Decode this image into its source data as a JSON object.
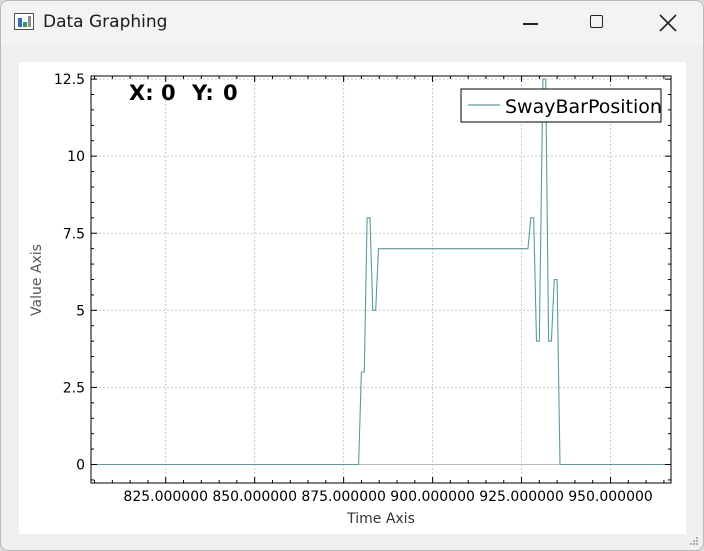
{
  "window": {
    "title": "Data Graphing",
    "icon": "chart-app-icon"
  },
  "titlebar_buttons": [
    "minimize-icon",
    "maximize-icon",
    "close-icon"
  ],
  "readout": {
    "x_label": "X:",
    "x_value": "0",
    "y_label": "Y:",
    "y_value": "0"
  },
  "chart_data": {
    "type": "line",
    "xlabel": "Time Axis",
    "ylabel": "Value Axis",
    "xlim": [
      804,
      967
    ],
    "ylim": [
      -0.6,
      12.6
    ],
    "x_ticks": [
      825,
      850,
      875,
      900,
      925,
      950
    ],
    "x_tick_labels": [
      "825.000000",
      "850.000000",
      "875.000000",
      "900.000000",
      "925.000000",
      "950.000000"
    ],
    "y_ticks": [
      0,
      2.5,
      5,
      7.5,
      10,
      12.5
    ],
    "y_tick_labels": [
      "0",
      "2.5",
      "5",
      "7.5",
      "10",
      "12.5"
    ],
    "grid": true,
    "legend_position": "top-right",
    "series": [
      {
        "name": "SwayBarPosition",
        "color": "#5b9aa0",
        "x": [
          804,
          879.2,
          880.0,
          880.8,
          881.6,
          882.4,
          883.2,
          884.0,
          884.8,
          885.6,
          926.0,
          926.8,
          927.6,
          928.4,
          929.2,
          930.0,
          931.0,
          931.8,
          932.6,
          933.4,
          934.2,
          935.0,
          935.8,
          936.6,
          937.4,
          938.2,
          967
        ],
        "y": [
          0,
          0,
          3,
          3,
          8,
          8,
          5,
          5,
          7,
          7,
          7,
          7,
          8,
          8,
          4,
          4,
          12.5,
          12.5,
          4,
          4,
          6,
          6,
          0,
          0,
          0,
          0,
          0
        ]
      }
    ]
  }
}
